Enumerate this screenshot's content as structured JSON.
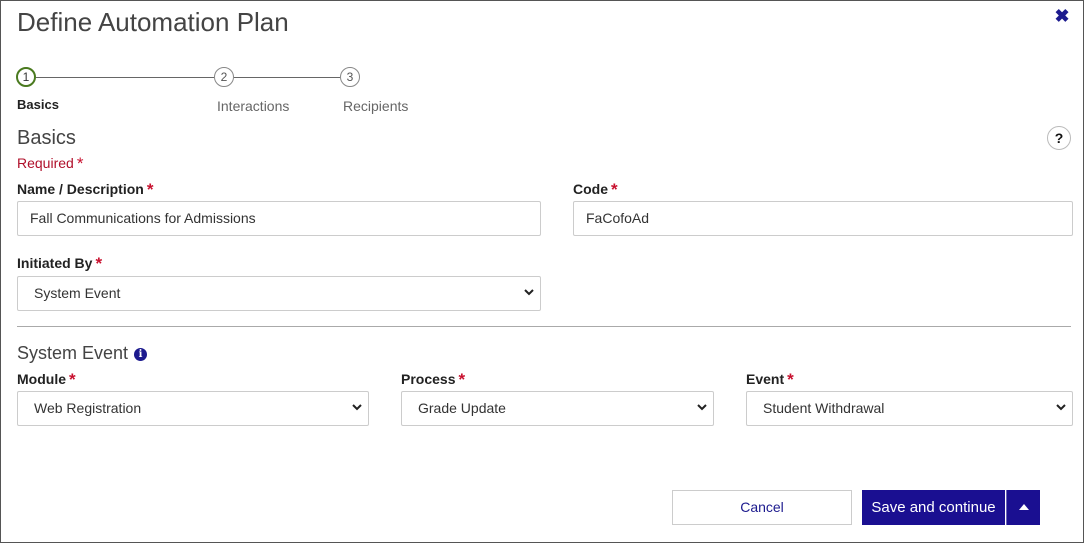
{
  "dialog": {
    "title": "Define Automation Plan",
    "close_icon": "close-icon"
  },
  "stepper": {
    "steps": [
      {
        "number": "1",
        "label": "Basics",
        "active": true
      },
      {
        "number": "2",
        "label": "Interactions",
        "active": false
      },
      {
        "number": "3",
        "label": "Recipients",
        "active": false
      }
    ]
  },
  "basics": {
    "title": "Basics",
    "help_label": "?",
    "required_note": "Required",
    "name_label": "Name / Description",
    "name_value": "Fall Communications for Admissions",
    "code_label": "Code",
    "code_value": "FaCofoAd",
    "initiated_label": "Initiated By",
    "initiated_value": "System Event"
  },
  "system_event": {
    "title": "System Event",
    "info_icon": "info-icon",
    "module_label": "Module",
    "module_value": "Web Registration",
    "process_label": "Process",
    "process_value": "Grade Update",
    "event_label": "Event",
    "event_value": "Student Withdrawal"
  },
  "footer": {
    "cancel_label": "Cancel",
    "save_label": "Save and continue"
  },
  "colors": {
    "primary": "#1a0f91",
    "required": "#c8102e",
    "step_active": "#4a7a1f"
  }
}
